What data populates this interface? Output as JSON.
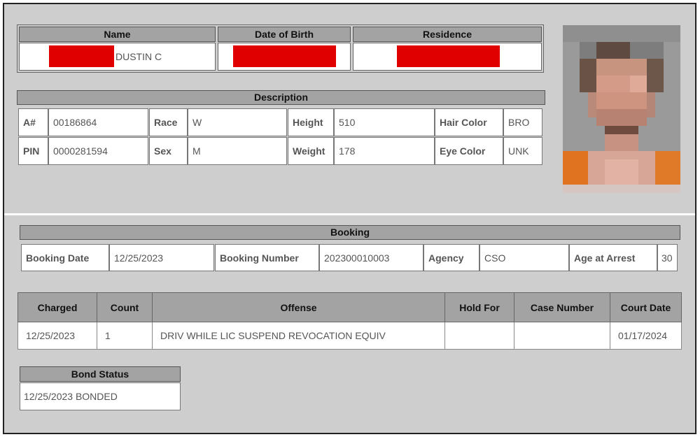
{
  "identity": {
    "name_header": "Name",
    "dob_header": "Date of Birth",
    "residence_header": "Residence",
    "name_value": "DUSTIN C"
  },
  "description": {
    "title": "Description",
    "row1": [
      {
        "label": "A#",
        "value": "00186864"
      },
      {
        "label": "Race",
        "value": "W"
      },
      {
        "label": "Height",
        "value": "510"
      },
      {
        "label": "Hair Color",
        "value": "BRO"
      }
    ],
    "row2": [
      {
        "label": "PIN",
        "value": "0000281594"
      },
      {
        "label": "Sex",
        "value": "M"
      },
      {
        "label": "Weight",
        "value": "178"
      },
      {
        "label": "Eye Color",
        "value": "UNK"
      }
    ]
  },
  "booking": {
    "title": "Booking",
    "booking_date_label": "Booking Date",
    "booking_date": "12/25/2023",
    "booking_number_label": "Booking Number",
    "booking_number": "202300010003",
    "agency_label": "Agency",
    "agency": "CSO",
    "age_label": "Age at Arrest",
    "age": "30"
  },
  "charges": {
    "headers": [
      "Charged",
      "Count",
      "Offense",
      "Hold For",
      "Case Number",
      "Court Date"
    ],
    "rows": [
      [
        "12/25/2023",
        "1",
        "DRIV WHILE LIC SUSPEND REVOCATION EQUIV",
        "",
        "",
        "01/17/2024"
      ]
    ]
  },
  "bond": {
    "title": "Bond Status",
    "value": "12/25/2023 BONDED"
  },
  "colors": {
    "redaction": "#e00000",
    "header_bg": "#a3a3a3",
    "panel_bg": "#cecece"
  }
}
